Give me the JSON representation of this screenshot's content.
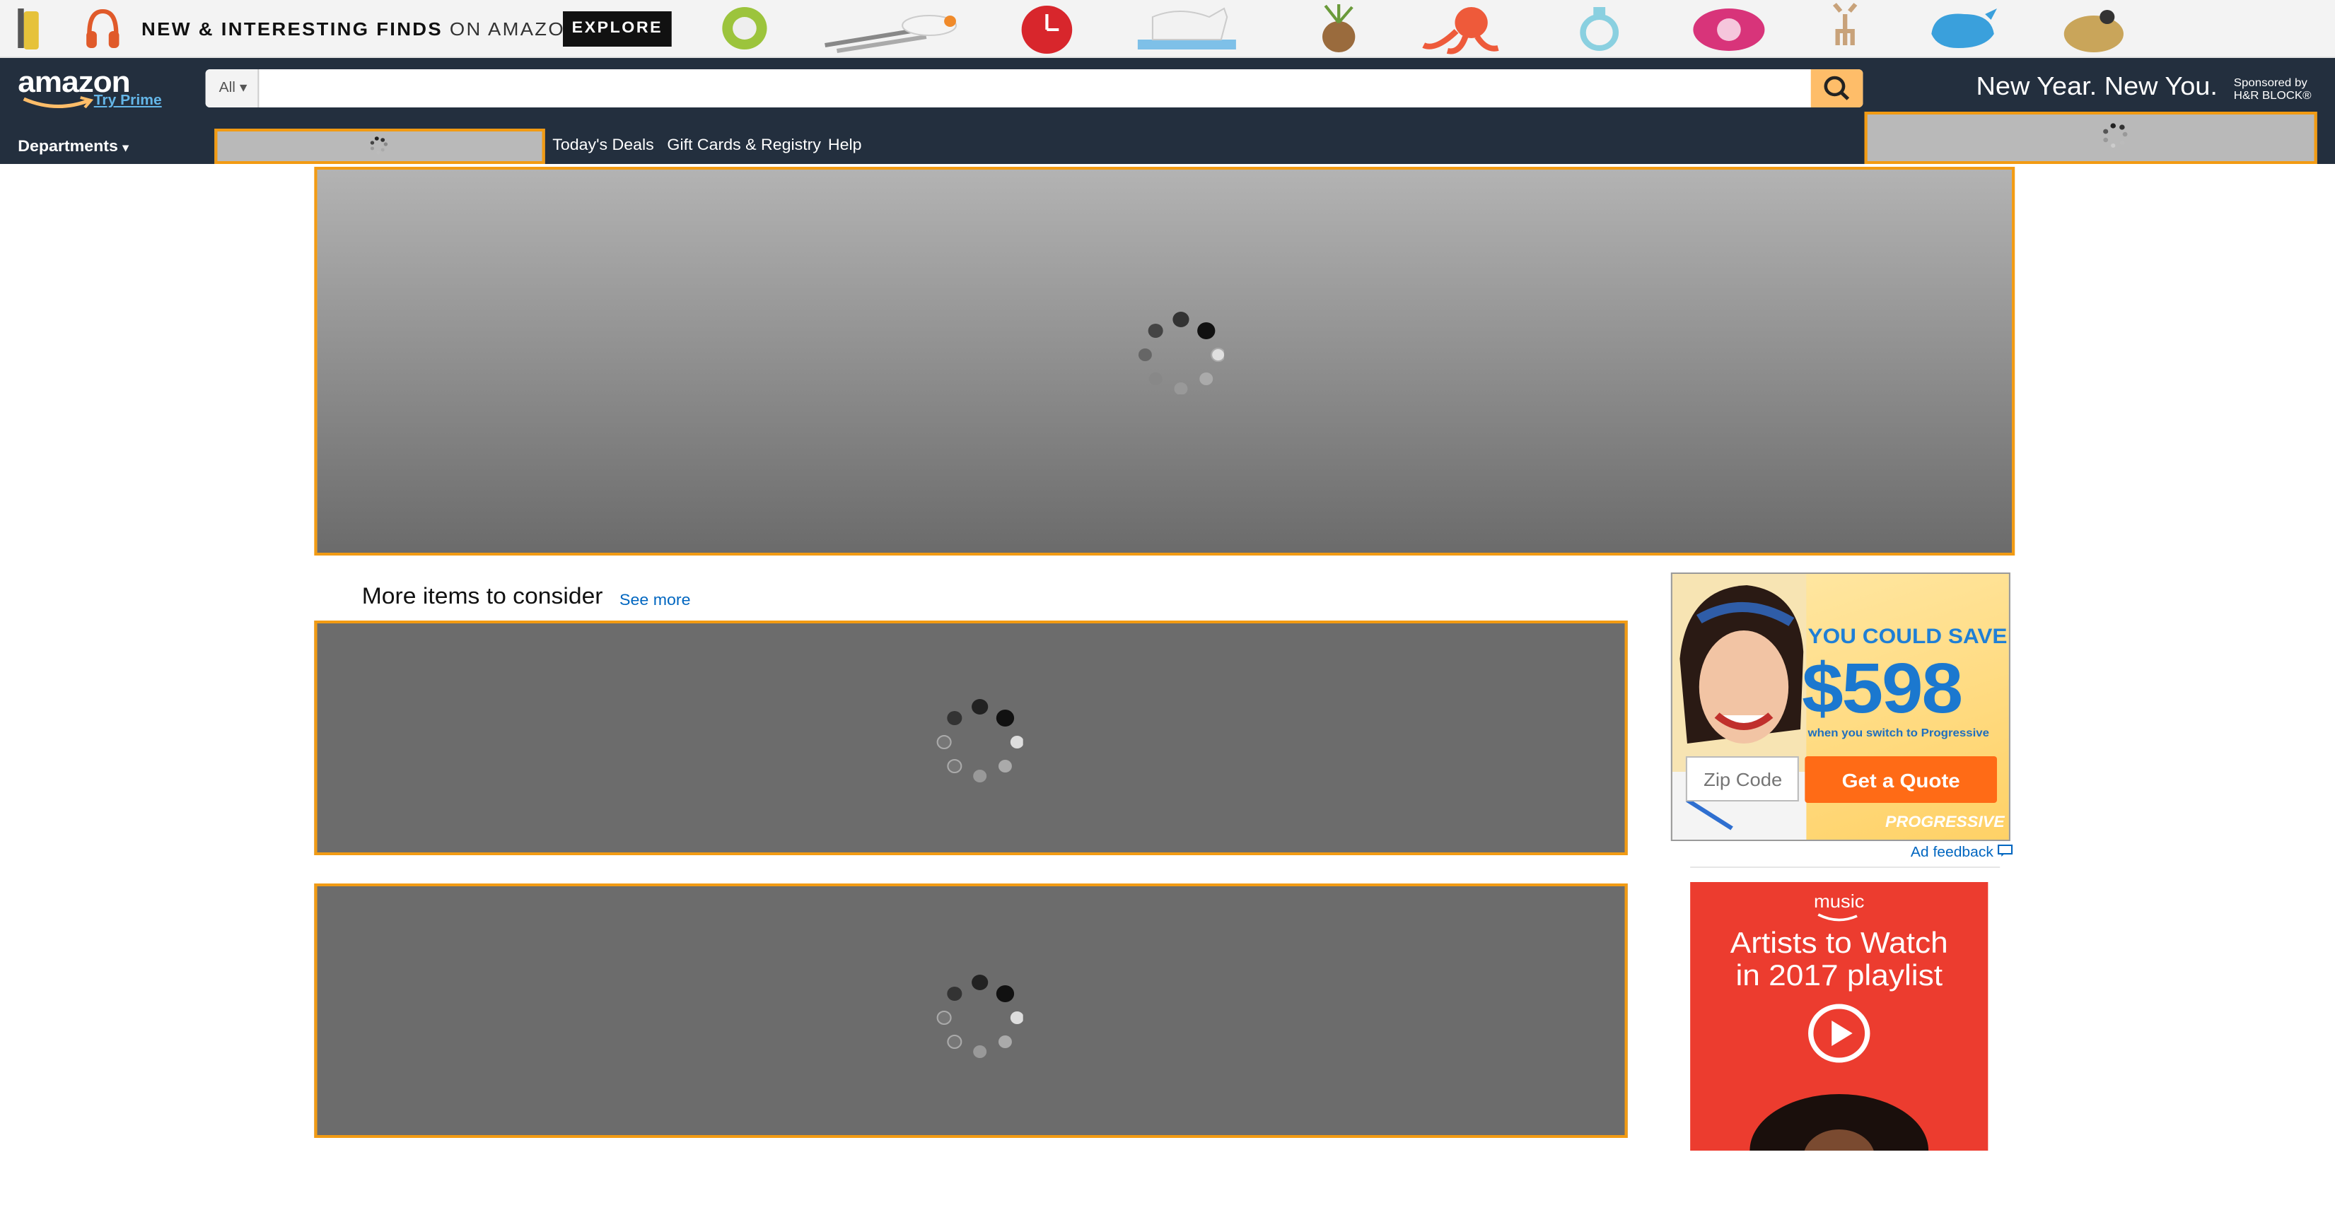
{
  "promo": {
    "headline_bold": "NEW & INTERESTING FINDS",
    "headline_light": "ON AMAZON",
    "explore_label": "EXPLORE",
    "products": [
      "headphones-icon",
      "shower-caddy-icon",
      "utensils-icon",
      "wall-clock-icon",
      "bookend-icon",
      "planter-icon",
      "octopus-toy-icon",
      "ring-icon",
      "speaker-icon",
      "deer-figurine-icon",
      "whale-toy-icon",
      "basket-icon"
    ]
  },
  "nav": {
    "logo_text": "amazon",
    "prime_text": "Try Prime",
    "search_category": "All",
    "search_placeholder": "",
    "tagline": "New Year. New You.",
    "sponsor_line1": "Sponsored by",
    "sponsor_line2": "H&R BLOCK®",
    "departments": "Departments",
    "links": [
      "Today's Deals",
      "Gift Cards & Registry",
      "Help"
    ],
    "accent": "#febd69",
    "bg": "#232f3e"
  },
  "main": {
    "section_title": "More items to consider",
    "see_more": "See more"
  },
  "ad": {
    "line1": "YOU COULD SAVE",
    "amount": "$598",
    "subline": "when you switch to Progressive",
    "zip_placeholder": "Zip Code",
    "button": "Get a Quote",
    "brand": "PROGRESSIVE",
    "feedback": "Ad feedback"
  },
  "music": {
    "logo": "music",
    "title_line1": "Artists to Watch",
    "title_line2": "in 2017 playlist"
  },
  "colors": {
    "placeholder_border": "#f29b13",
    "link": "#0066c0"
  }
}
